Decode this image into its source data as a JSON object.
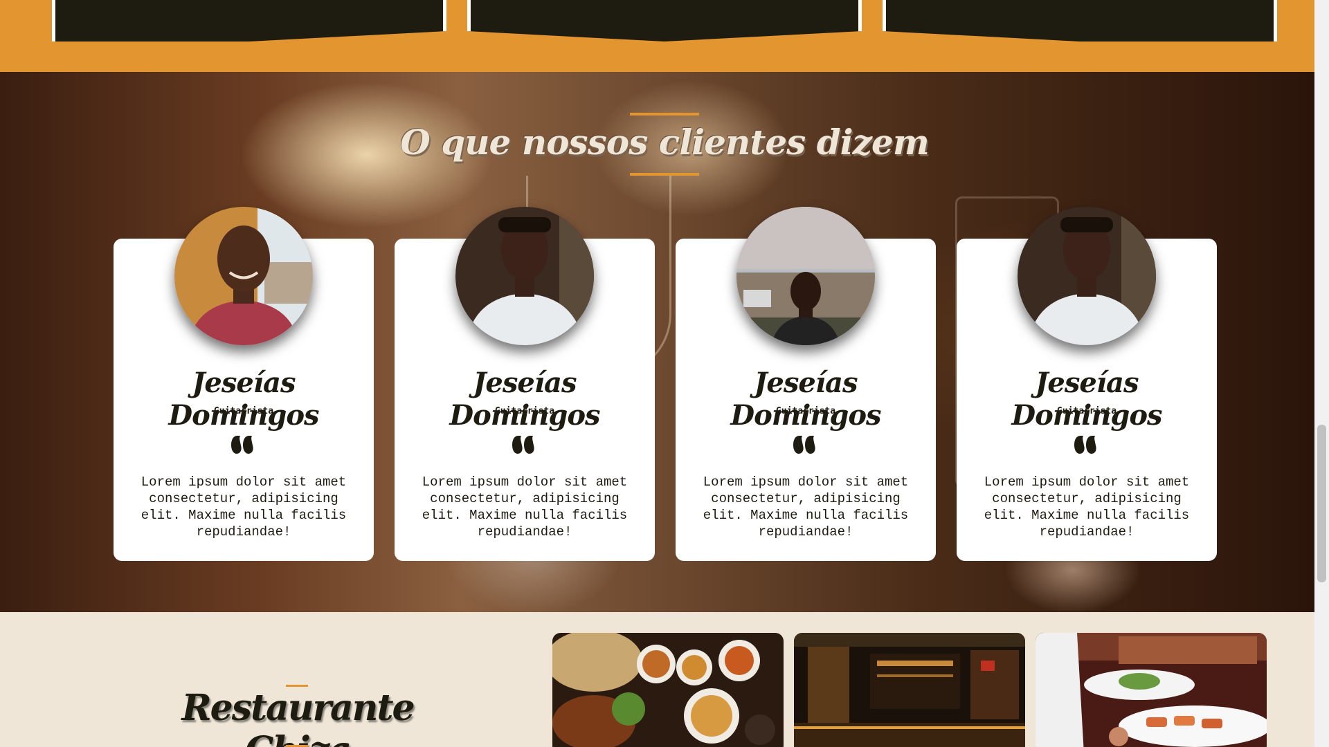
{
  "testimonials": {
    "title": "O que nossos clientes dizem",
    "cards": [
      {
        "name": "Jeseías Domingos",
        "role": "Guitarrista",
        "text": "Lorem ipsum dolor sit amet consectetur, adipisicing elit. Maxime nulla facilis repudiandae!",
        "avatar_icon": "person-photo-red-shirt"
      },
      {
        "name": "Jeseías Domingos",
        "role": "Guitarrista",
        "text": "Lorem ipsum dolor sit amet consectetur, adipisicing elit. Maxime nulla facilis repudiandae!",
        "avatar_icon": "person-photo-white-tshirt"
      },
      {
        "name": "Jeseías Domingos",
        "role": "Guitarrista",
        "text": "Lorem ipsum dolor sit amet consectetur, adipisicing elit. Maxime nulla facilis repudiandae!",
        "avatar_icon": "person-photo-sky"
      },
      {
        "name": "Jeseías Domingos",
        "role": "Guitarrista",
        "text": "Lorem ipsum dolor sit amet consectetur, adipisicing elit. Maxime nulla facilis repudiandae!",
        "avatar_icon": "person-photo-white-tshirt"
      }
    ],
    "quote_icon": "quote-icon"
  },
  "restaurant": {
    "title": "Restaurante Chiza",
    "gallery": [
      {
        "icon": "food-dishes-photo"
      },
      {
        "icon": "restaurant-interior-photo"
      },
      {
        "icon": "plated-food-photo"
      }
    ]
  },
  "colors": {
    "accent": "#e39530",
    "dark": "#1e1c10",
    "cream": "#efe6d8",
    "card": "#ffffff"
  }
}
